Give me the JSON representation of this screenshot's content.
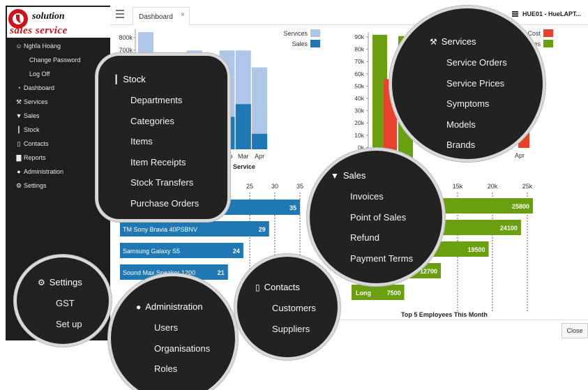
{
  "logo": {
    "line1": "solution",
    "line2": "sales service"
  },
  "sidebar": {
    "items": [
      {
        "label": "Nghĩa Hoàng",
        "icon": "user-icon",
        "glyph": "☺"
      },
      {
        "label": "Change Password",
        "sub": true
      },
      {
        "label": "Log Off",
        "sub": true
      },
      {
        "label": "Dashboard",
        "icon": "dashboard-icon",
        "glyph": "◔"
      },
      {
        "label": "Services",
        "icon": "wrench-icon",
        "glyph": "⚒"
      },
      {
        "label": "Sales",
        "icon": "cart-icon",
        "glyph": "▼"
      },
      {
        "label": "Stock",
        "icon": "barcode-icon",
        "glyph": "┃"
      },
      {
        "label": "Contacts",
        "icon": "phone-icon",
        "glyph": "▯"
      },
      {
        "label": "Reports",
        "icon": "bar-chart-icon",
        "glyph": "▇"
      },
      {
        "label": "Administration",
        "icon": "globe-icon",
        "glyph": "●"
      },
      {
        "label": "Settings",
        "icon": "gear-icon",
        "glyph": "⚙"
      }
    ]
  },
  "topbar": {
    "tab_label": "Dashboard",
    "tab_close": "×",
    "user_label": "HUE01 - HueLAPT..."
  },
  "footer": {
    "close_label": "Close",
    "employees_title": "Top 5 Employees This Month"
  },
  "colors": {
    "services": "#aec7e8",
    "sales": "#1f77b4",
    "cost": "#e8412c",
    "green": "#6aa00f",
    "panel": "#222222"
  },
  "chart_data": [
    {
      "type": "bar",
      "series": [
        {
          "name": "Services",
          "values": [
            830000,
            0,
            0,
            700000,
            660000,
            700000,
            700000,
            580000
          ]
        },
        {
          "name": "Sales",
          "values": [
            400000,
            0,
            0,
            230000,
            220000,
            230000,
            320000,
            110000
          ]
        }
      ],
      "categories": [
        "",
        "",
        "",
        "",
        "Jan",
        "Feb",
        "Mar",
        "Apr"
      ],
      "yticks": [
        "800k",
        "700k"
      ],
      "xlabel": "Service",
      "ylim": [
        0,
        850000
      ]
    },
    {
      "type": "bar",
      "series": [
        {
          "name": "Cost",
          "values": [
            0,
            60000,
            0,
            0,
            0,
            0
          ]
        },
        {
          "name": "Sales",
          "values": [
            93000,
            0,
            92000,
            0,
            0,
            0
          ]
        }
      ],
      "yticks": [
        "90k",
        "80k",
        "70k",
        "60k",
        "50k",
        "40k",
        "30k",
        "20k",
        "10k",
        "0k"
      ],
      "ylim": [
        0,
        95000
      ],
      "visible_text": [
        "Cost",
        "les",
        "Apr"
      ]
    },
    {
      "type": "bar",
      "orientation": "horizontal",
      "categories": [
        "",
        "TM Sony Bravia 40PSBNV",
        "Samsung Galaxy S5",
        "Sound Max Speaker 1200",
        ""
      ],
      "values": [
        35,
        29,
        24,
        21,
        0
      ],
      "xticks": [
        "25",
        "30",
        "35"
      ],
      "xlim": [
        0,
        36
      ]
    },
    {
      "type": "bar",
      "orientation": "horizontal",
      "title": "Top 5 Employees This Month",
      "categories": [
        "",
        "",
        "",
        "",
        "Long"
      ],
      "values": [
        25800,
        24100,
        19500,
        12700,
        7500
      ],
      "xticks": [
        "15k",
        "20k",
        "25k"
      ],
      "xlim": [
        0,
        27000
      ]
    }
  ],
  "popups": {
    "stock": {
      "title": "Stock",
      "items": [
        "Departments",
        "Categories",
        "Items",
        "Item Receipts",
        "Stock Transfers",
        "Purchase Orders"
      ]
    },
    "services": {
      "title": "Services",
      "items": [
        "Service Orders",
        "Service Prices",
        "Symptoms",
        "Models",
        "Brands"
      ]
    },
    "sales": {
      "title": "Sales",
      "items": [
        "Invoices",
        "Point of Sales",
        "Refund",
        "Payment Terms"
      ]
    },
    "settings": {
      "title": "Settings",
      "items": [
        "GST",
        "Set up"
      ]
    },
    "administration": {
      "title": "Administration",
      "items": [
        "Users",
        "Organisations",
        "Roles"
      ]
    },
    "contacts": {
      "title": "Contacts",
      "items": [
        "Customers",
        "Suppliers"
      ]
    }
  }
}
